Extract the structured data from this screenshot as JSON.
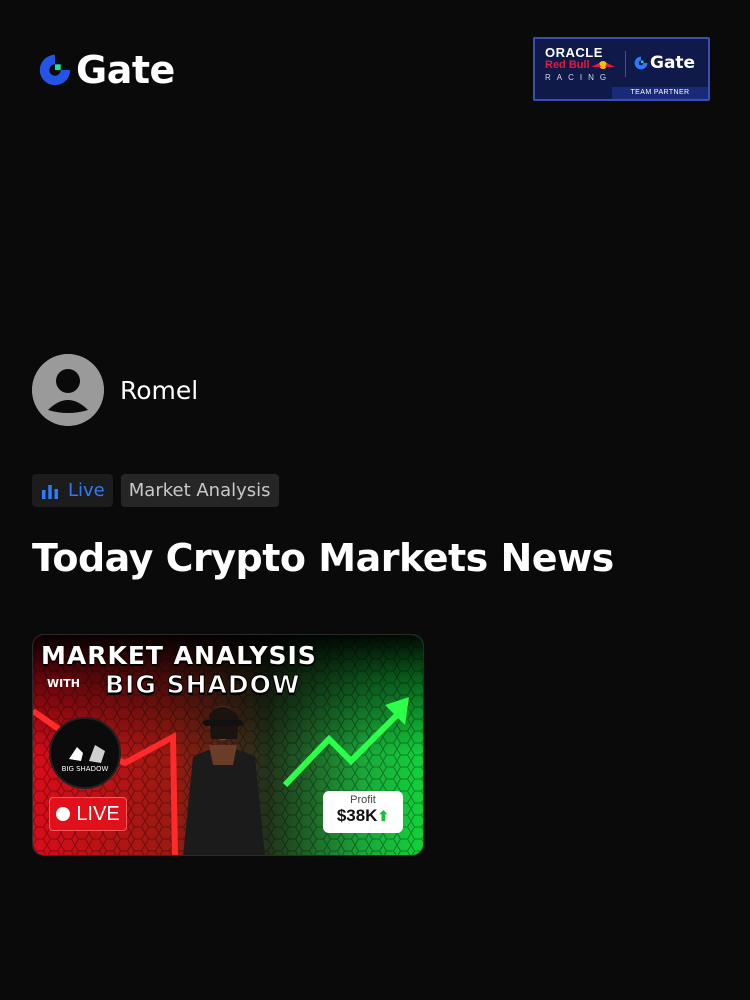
{
  "header": {
    "brand": "Gate",
    "partner_badge": {
      "oracle": "ORACLE",
      "redbull": "Red Bull",
      "racing": "RACING",
      "gate": "Gate",
      "team_partner": "TEAM PARTNER"
    }
  },
  "author": {
    "name": "Romel",
    "avatar_icon": "user-avatar-icon"
  },
  "tags": {
    "live_label": "Live",
    "live_icon": "bar-chart-icon",
    "category_label": "Market Analysis"
  },
  "post": {
    "title": "Today Crypto Markets News"
  },
  "thumbnail": {
    "headline": "MARKET ANALYSIS",
    "with": "WITH",
    "name": "BIG SHADOW",
    "logo_text": "BIG SHADOW",
    "live_label": "LIVE",
    "profit_label": "Profit",
    "profit_value": "$38K"
  },
  "colors": {
    "background": "#0a0a0a",
    "accent_blue": "#2f7bff",
    "live_red": "#e0111b",
    "profit_green": "#14c23c",
    "brand_gate_blue": "#2354e6",
    "brand_gate_green": "#17e5a2"
  }
}
